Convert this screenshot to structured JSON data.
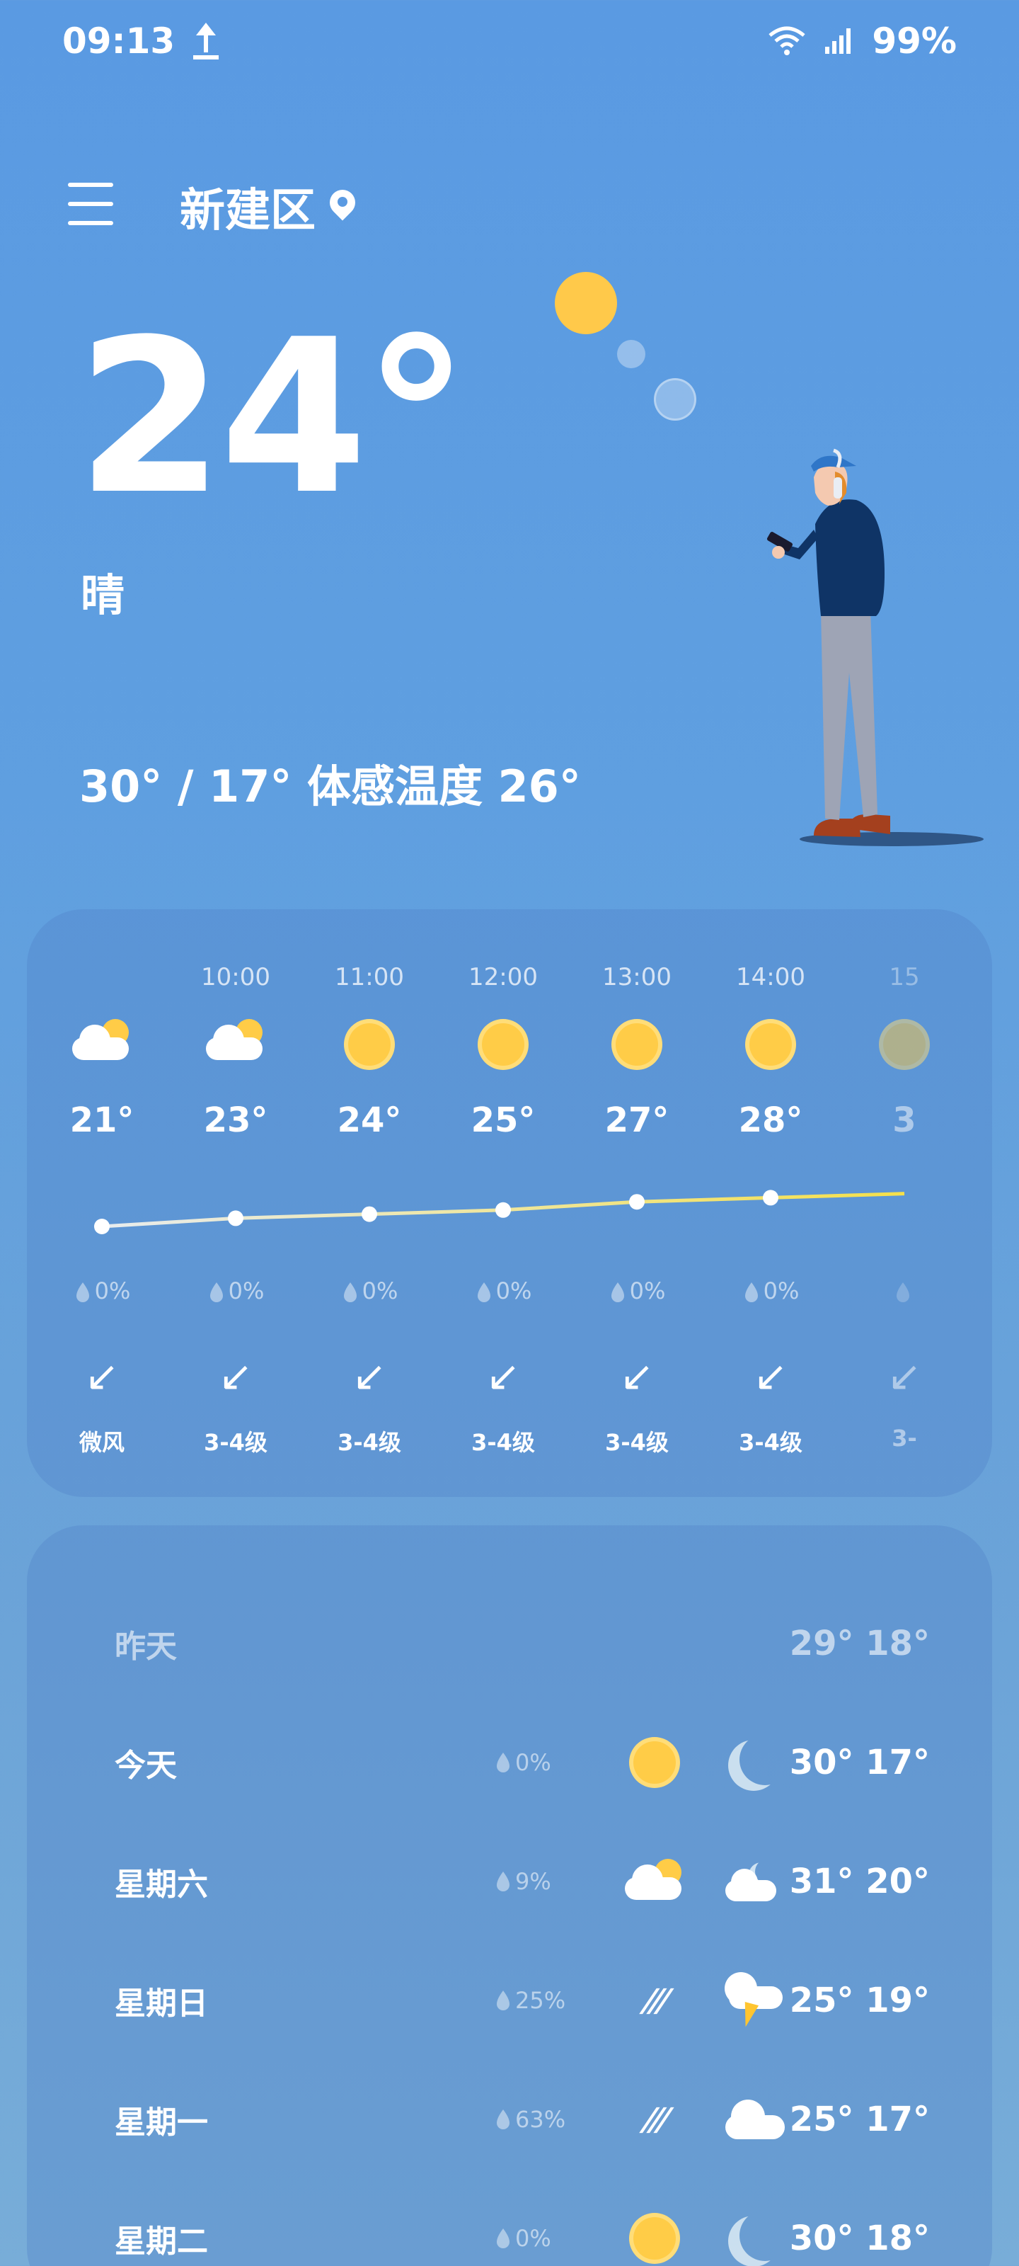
{
  "status_bar": {
    "time": "09:13",
    "battery": "99%"
  },
  "header": {
    "location": "新建区"
  },
  "current": {
    "temperature": "24°",
    "condition": "晴",
    "range_line": "30° / 17° 体感温度 26°"
  },
  "hourly": [
    {
      "time": "",
      "icon": "cloud-sun-icon",
      "temp": "21°",
      "rain": "0%",
      "wind": "微风",
      "value": 21
    },
    {
      "time": "10:00",
      "icon": "cloud-sun-icon",
      "temp": "23°",
      "rain": "0%",
      "wind": "3-4级",
      "value": 23
    },
    {
      "time": "11:00",
      "icon": "sun-icon",
      "temp": "24°",
      "rain": "0%",
      "wind": "3-4级",
      "value": 24
    },
    {
      "time": "12:00",
      "icon": "sun-icon",
      "temp": "25°",
      "rain": "0%",
      "wind": "3-4级",
      "value": 25
    },
    {
      "time": "13:00",
      "icon": "sun-icon",
      "temp": "27°",
      "rain": "0%",
      "wind": "3-4级",
      "value": 27
    },
    {
      "time": "14:00",
      "icon": "sun-icon",
      "temp": "28°",
      "rain": "0%",
      "wind": "3-4级",
      "value": 28
    },
    {
      "time": "15",
      "icon": "sun-icon",
      "temp": "3",
      "rain": "",
      "wind": "3-",
      "value": 29
    }
  ],
  "daily": [
    {
      "day": "昨天",
      "rain": "",
      "day_icon": "",
      "night_icon": "",
      "temps": "29° 18°",
      "muted": true
    },
    {
      "day": "今天",
      "rain": "0%",
      "day_icon": "sun-icon",
      "night_icon": "moon-icon",
      "temps": "30° 17°"
    },
    {
      "day": "星期六",
      "rain": "9%",
      "day_icon": "cloud-sun-icon",
      "night_icon": "cloud-moon-icon",
      "temps": "31° 20°"
    },
    {
      "day": "星期日",
      "rain": "25%",
      "day_icon": "rain-icon",
      "night_icon": "thunderstorm-icon",
      "temps": "25° 19°"
    },
    {
      "day": "星期一",
      "rain": "63%",
      "day_icon": "rain-icon",
      "night_icon": "cloud-icon",
      "temps": "25° 17°"
    },
    {
      "day": "星期二",
      "rain": "0%",
      "day_icon": "sun-icon",
      "night_icon": "moon-icon",
      "temps": "30° 18°"
    }
  ],
  "colors": {
    "sun": "#ffcc47",
    "temp_line": "#f5e04a",
    "background": "#5a9ae2"
  }
}
